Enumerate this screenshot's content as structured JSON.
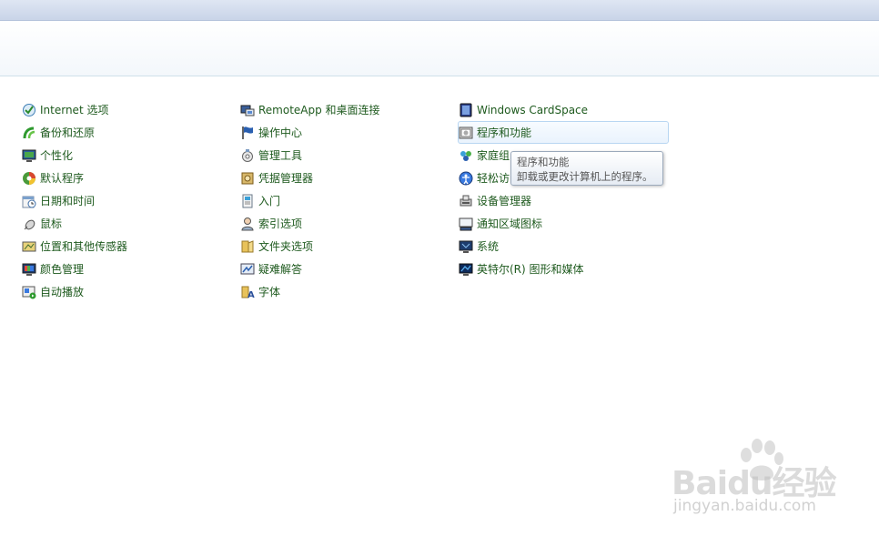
{
  "columns": [
    [
      {
        "icon": "internet-options-icon",
        "label": "Internet 选项"
      },
      {
        "icon": "backup-restore-icon",
        "label": "备份和还原"
      },
      {
        "icon": "personalization-icon",
        "label": "个性化"
      },
      {
        "icon": "default-programs-icon",
        "label": "默认程序"
      },
      {
        "icon": "date-time-icon",
        "label": "日期和时间"
      },
      {
        "icon": "mouse-icon",
        "label": "鼠标"
      },
      {
        "icon": "location-sensors-icon",
        "label": "位置和其他传感器"
      },
      {
        "icon": "color-management-icon",
        "label": "颜色管理"
      },
      {
        "icon": "autoplay-icon",
        "label": "自动播放"
      }
    ],
    [
      {
        "icon": "remoteapp-icon",
        "label": "RemoteApp 和桌面连接"
      },
      {
        "icon": "action-center-flag-icon",
        "label": "操作中心"
      },
      {
        "icon": "admin-tools-icon",
        "label": "管理工具"
      },
      {
        "icon": "credential-manager-icon",
        "label": "凭据管理器"
      },
      {
        "icon": "getting-started-icon",
        "label": "入门"
      },
      {
        "icon": "indexing-options-icon",
        "label": "索引选项"
      },
      {
        "icon": "folder-options-icon",
        "label": "文件夹选项"
      },
      {
        "icon": "troubleshooting-icon",
        "label": "疑难解答"
      },
      {
        "icon": "fonts-icon",
        "label": "字体"
      }
    ],
    [
      {
        "icon": "cardspace-icon",
        "label": "Windows CardSpace"
      },
      {
        "icon": "programs-features-icon",
        "label": "程序和功能"
      },
      {
        "icon": "homegroup-icon",
        "label": "家庭组"
      },
      {
        "icon": "ease-of-access-icon",
        "label": "轻松访问中心"
      },
      {
        "icon": "device-manager-icon",
        "label": "设备管理器"
      },
      {
        "icon": "notification-icons-icon",
        "label": "通知区域图标"
      },
      {
        "icon": "system-icon",
        "label": "系统"
      },
      {
        "icon": "intel-graphics-icon",
        "label": "英特尔(R) 图形和媒体"
      }
    ]
  ],
  "hovered_item": "程序和功能",
  "tooltip": {
    "title": "程序和功能",
    "description": "卸载或更改计算机上的程序。"
  },
  "watermark": {
    "brand": "Baidu经验",
    "site": "jingyan.baidu.com"
  },
  "colors": {
    "link_text": "#1e5a1e",
    "hover_border": "#b8d6f2",
    "header_line": "#cfe1ea"
  }
}
